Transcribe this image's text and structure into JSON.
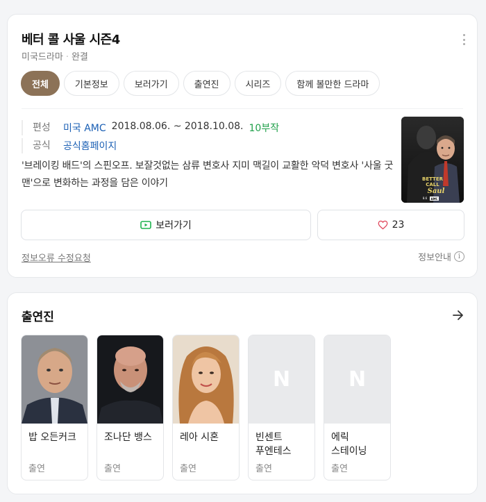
{
  "show": {
    "title": "베터 콜 사울 시즌4",
    "genre": "미국드라마",
    "status": "완결"
  },
  "tabs": [
    "전체",
    "기본정보",
    "보러가기",
    "출연진",
    "시리즈",
    "함께 볼만한 드라마"
  ],
  "info": {
    "broadcast_label": "편성",
    "network": "미국 AMC",
    "dates": "2018.08.06. ~ 2018.10.08.",
    "episodes": "10부작",
    "official_label": "공식",
    "official_link": "공식홈페이지"
  },
  "description": "'브레이킹 배드'의 스핀오프. 보잘것없는 삼류 변호사 지미 맥길이 교활한 악덕 변호사 '사울 굿맨'으로 변화하는 과정을 담은 이야기",
  "poster": {
    "title_line1": "BETTER",
    "title_line2": "CALL",
    "title_line3": "Saul",
    "badge": "AMC",
    "date": "8.6"
  },
  "actions": {
    "watch_label": "보러가기",
    "like_count": "23"
  },
  "footer": {
    "report_link": "정보오류 수정요청",
    "info_guide": "정보안내",
    "info_glyph": "i"
  },
  "cast_section": {
    "title": "출연진",
    "members": [
      {
        "name": "밥 오든커크",
        "role": "출연",
        "photo": "bob"
      },
      {
        "name": "조나단 뱅스",
        "role": "출연",
        "photo": "jonathan"
      },
      {
        "name": "레아 시혼",
        "role": "출연",
        "photo": "rhea"
      },
      {
        "name": "빈센트 푸엔테스",
        "role": "출연",
        "photo": "placeholder"
      },
      {
        "name": "에릭 스테이닝",
        "role": "출연",
        "photo": "placeholder"
      }
    ],
    "placeholder_letter": "N"
  },
  "colors": {
    "accent_tab": "#8c7257",
    "link": "#1a5fb4",
    "episodes": "#1fa04a",
    "heart": "#e0465b",
    "play_icon": "#1fb34f"
  }
}
